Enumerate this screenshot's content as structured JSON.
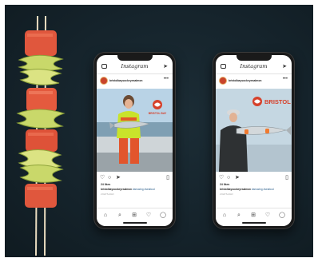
{
  "colors": {
    "background": "#15232b",
    "salmon": "#e0573d",
    "zucchini": "#c9d86a",
    "brand_red": "#d6402a"
  },
  "posts": [
    {
      "app_title": "Instagram",
      "username": "bristolbaysockeyesalmon",
      "likes": "24 likes",
      "caption_user": "bristolbaysockeyesalmon",
      "caption_tag": "#amazing #seafood",
      "posted": "2 DAYS AGO",
      "photo_brand": "BRISTOL BAY"
    },
    {
      "app_title": "Instagram",
      "username": "bristolbaysockeyesalmon",
      "likes": "24 likes",
      "caption_user": "bristolbaysockeyesalmon",
      "caption_tag": "#amazing #seafood",
      "posted": "2 DAYS AGO",
      "photo_brand": "BRISTOL BAY"
    }
  ],
  "icons": {
    "camera": "camera-icon",
    "send": "send-icon",
    "more": "more-icon",
    "like": "heart-icon",
    "comment": "comment-icon",
    "share": "send-icon",
    "save": "bookmark-icon",
    "tabs": [
      "home-icon",
      "search-icon",
      "add-post-icon",
      "heart-icon",
      "profile-icon"
    ]
  }
}
